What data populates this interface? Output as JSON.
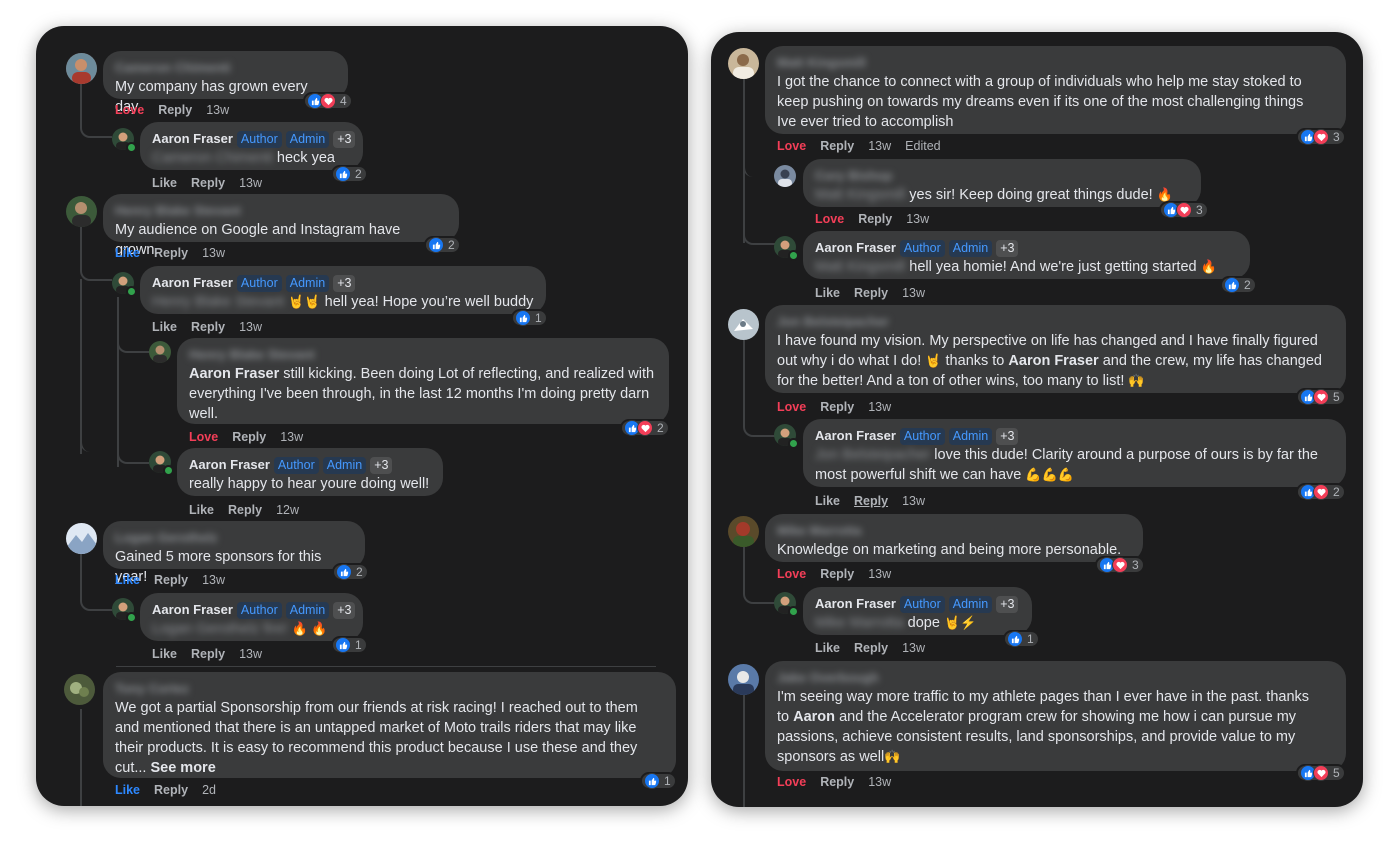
{
  "left": {
    "c1": {
      "name": "Cameron Chimenti",
      "text": "My company has grown every day.",
      "actions": [
        "Love",
        "Reply"
      ],
      "time": "13w",
      "react_count": "4"
    },
    "r1": {
      "name": "Aaron Fraser",
      "badges": [
        "Author",
        "Admin",
        "+3"
      ],
      "tag": "Cameron Chimenti",
      "text": "heck yea",
      "actions": [
        "Like",
        "Reply"
      ],
      "time": "13w",
      "react_count": "2"
    },
    "c2": {
      "name": "Henry Blake Stevant",
      "text": "My audience on Google and Instagram have grown.",
      "actions": [
        "Like",
        "Reply"
      ],
      "time": "13w",
      "react_count": "2"
    },
    "r2": {
      "name": "Aaron Fraser",
      "badges": [
        "Author",
        "Admin",
        "+3"
      ],
      "tag": "Henry Blake Stevant",
      "emoji": "🤘🤘",
      "text": "hell yea! Hope you’re well buddy",
      "actions": [
        "Like",
        "Reply"
      ],
      "time": "13w",
      "react_count": "1"
    },
    "r3": {
      "name": "Henry Blake Stevant",
      "tag": "Aaron Fraser",
      "text_first": "still kicking. Been doing Lot of reflecting, and realized with",
      "text_rest": "everything I've been through, in the last 12 months I'm doing pretty darn",
      "text_end": "well.",
      "actions": [
        "Love",
        "Reply"
      ],
      "time": "13w",
      "react_count": "2"
    },
    "r4": {
      "name": "Aaron Fraser",
      "badges": [
        "Author",
        "Admin",
        "+3"
      ],
      "text": "really happy to hear youre doing well!",
      "actions": [
        "Like",
        "Reply"
      ],
      "time": "12w"
    },
    "c3": {
      "name": "Logan Gerothelz",
      "text": "Gained 5 more sponsors for this year!",
      "actions": [
        "Like",
        "Reply"
      ],
      "time": "13w",
      "react_count": "2"
    },
    "r5": {
      "name": "Aaron Fraser",
      "badges": [
        "Author",
        "Admin",
        "+3"
      ],
      "tag": "Logan Gerothelz fire!",
      "emoji": "🔥 🔥",
      "actions": [
        "Like",
        "Reply"
      ],
      "time": "13w",
      "react_count": "1"
    },
    "c4": {
      "name": "Tony Cortez",
      "lines": [
        "We got a partial Sponsorship from our friends at risk racing! I reached out to them",
        "and mentioned that there is an untapped market of Moto trails riders that may like",
        "their products. It is easy to recommend this product because I use these and they"
      ],
      "last": "cut...",
      "see_more": "See more",
      "actions": [
        "Like",
        "Reply"
      ],
      "time": "2d",
      "react_count": "1"
    }
  },
  "right": {
    "c1": {
      "name": "Matt Kingsmill",
      "lines": [
        "I got the chance to connect with a group of individuals who help me stay stoked to",
        "keep pushing on towards my dreams even if its one of the most challenging things",
        "Ive ever tried to accomplish"
      ],
      "actions": [
        "Love",
        "Reply"
      ],
      "time": "13w",
      "edited": "Edited",
      "react_count": "3"
    },
    "r1": {
      "name": "Cory Bishop",
      "tag": "Matt Kingsmill",
      "text": "yes sir! Keep doing great things dude!",
      "emoji": "🔥",
      "actions": [
        "Love",
        "Reply"
      ],
      "time": "13w",
      "react_count": "3"
    },
    "r2": {
      "name": "Aaron Fraser",
      "badges": [
        "Author",
        "Admin",
        "+3"
      ],
      "tag": "Matt Kingsmill",
      "text": "hell yea homie! And we're just getting started",
      "emoji": "🔥",
      "actions": [
        "Like",
        "Reply"
      ],
      "time": "13w",
      "react_count": "2"
    },
    "c2": {
      "name": "Jon Belsteipacher",
      "line1": "I have found my vision. My perspective on life has changed and I have finally figured",
      "line2a": "out why i do what I do!",
      "line2emoji": "🤘",
      "line2b": "thanks to",
      "line2tag": "Aaron Fraser",
      "line2c": "and the crew, my life has changed",
      "line3": "for the better! And a ton of other wins, too many to list!",
      "line3emoji": "🙌",
      "actions": [
        "Love",
        "Reply"
      ],
      "time": "13w",
      "react_count": "5"
    },
    "r3": {
      "name": "Aaron Fraser",
      "badges": [
        "Author",
        "Admin",
        "+3"
      ],
      "tag": "Jon Belsteipacher",
      "line1": "love this dude! Clarity around a purpose of ours is by far the",
      "line2": "most powerful shift we can have",
      "emoji": "💪💪💪",
      "actions": [
        "Like",
        "Reply"
      ],
      "time": "13w",
      "react_count": "2"
    },
    "c3": {
      "name": "Mike Marrotta",
      "text": "Knowledge on marketing and being more personable.",
      "actions": [
        "Love",
        "Reply"
      ],
      "time": "13w",
      "react_count": "3"
    },
    "r4": {
      "name": "Aaron Fraser",
      "badges": [
        "Author",
        "Admin",
        "+3"
      ],
      "tag": "Mike Marrotta",
      "text": "dope",
      "emoji": "🤘⚡",
      "actions": [
        "Like",
        "Reply"
      ],
      "time": "13w",
      "react_count": "1"
    },
    "c4": {
      "name": "Jake Overbough",
      "line1": "I'm seeing way more traffic to my athlete pages than I ever have in the past. thanks",
      "line2a": "to",
      "line2tag": "Aaron",
      "line2b": "and the Accelerator program crew for showing me how i can pursue my",
      "line3": "passions, achieve consistent results, land sponsorships, and provide value to my",
      "line4": "sponsors as well",
      "line4emoji": "🙌",
      "actions": [
        "Love",
        "Reply"
      ],
      "time": "13w",
      "react_count": "5"
    }
  },
  "colors": {
    "panel_bg": "#1c1c1d",
    "bubble_bg": "#3a3b3c",
    "text": "#e4e6eb",
    "muted": "#b0b3b8",
    "love": "#f33e58",
    "like": "#2d88ff",
    "badge_bg": "#263951",
    "badge_text": "#4599ff",
    "online": "#31a24c"
  },
  "icons": [
    "like-icon",
    "love-icon",
    "avatar-icon",
    "online-dot-icon"
  ]
}
